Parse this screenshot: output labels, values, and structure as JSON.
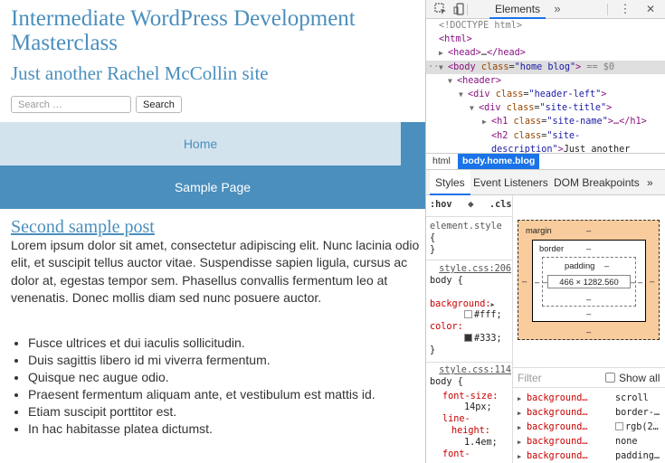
{
  "site": {
    "name": "Intermediate WordPress Development Masterclass",
    "description": "Just another Rachel McCollin site",
    "search": {
      "placeholder": "Search …",
      "button_label": "Search"
    },
    "nav": [
      {
        "label": "Home"
      },
      {
        "label": "Sample Page"
      }
    ],
    "post": {
      "title": "Second sample post",
      "body": "Lorem ipsum dolor sit amet, consectetur adipiscing elit. Nunc lacinia odio elit, et suscipit tellus auctor vitae. Suspendisse sapien ligula, cursus ac dolor at, egestas tempor sem. Phasellus convallis fermentum leo at venenatis. Donec mollis diam sed nunc posuere auctor.",
      "list": [
        "Fusce ultrices et dui iaculis sollicitudin.",
        "Duis sagittis libero id mi viverra fermentum.",
        "Quisque nec augue odio.",
        "Praesent fermentum aliquam ante, et vestibulum est mattis id.",
        "Etiam suscipit porttitor est.",
        "In hac habitasse platea dictumst."
      ]
    }
  },
  "devtools": {
    "toolbar": {
      "elements_tab": "Elements",
      "more": "»",
      "menu": "⋮",
      "close": "✕"
    },
    "dom": {
      "doctype": "<!DOCTYPE html>",
      "html_tag": "<html>",
      "head_line": {
        "open": "<head>",
        "ellipsis": "…",
        "close": "</head>"
      },
      "body_line": {
        "tag": "<body",
        "attr": "class",
        "val": "\"home blog\"",
        "close": ">",
        "marker": "== $0"
      },
      "header_tag": "<header>",
      "div_header_left": {
        "tag": "<div",
        "attr": "class",
        "val": "\"header-left\"",
        "close": ">"
      },
      "div_site_title": {
        "tag": "<div",
        "attr": "class",
        "val": "\"site-title\"",
        "close": ">"
      },
      "h1_line": {
        "tag": "<h1",
        "attr": "class",
        "val": "\"site-name\"",
        "rest": ">…</h1>"
      },
      "h2_line1": {
        "tag": "<h2",
        "attr": "class",
        "val": "\"site-"
      },
      "h2_line2": {
        "val": "description\"",
        "close": ">",
        "text": "Just another"
      }
    },
    "breadcrumbs": {
      "html": "html",
      "body": "body.home.blog"
    },
    "pane_tabs": {
      "styles": "Styles",
      "events": "Event Listeners",
      "dom_breakpoints": "DOM Breakpoints",
      "more": "»"
    },
    "styles_filter": {
      "hov": ":hov",
      "cls": ".cls"
    },
    "rules": {
      "element_style": {
        "selector": "element.style",
        "open": "{",
        "close": "}"
      },
      "rule1": {
        "source": "style.css:206",
        "selector": "body {",
        "prop1": "background:",
        "val1": "#fff;",
        "prop2": "color:",
        "val2": "#333;",
        "close": "}"
      },
      "rule2": {
        "source": "style.css:114",
        "selector": "body {",
        "prop1": "font-size:",
        "val1": "14px;",
        "prop2a": "line-",
        "prop2b": "height:",
        "val2": "1.4em;",
        "prop3": "font-"
      }
    },
    "box_model": {
      "margin_label": "margin",
      "border_label": "border",
      "padding_label": "padding",
      "content_size": "466 × 1282.560",
      "dash": "–"
    },
    "computed": {
      "filter_placeholder": "Filter",
      "show_all": "Show all",
      "rows": [
        {
          "prop": "background…",
          "val": "scroll"
        },
        {
          "prop": "background…",
          "val": "border-…"
        },
        {
          "prop": "background…",
          "val": "rgb(2…"
        },
        {
          "prop": "background…",
          "val": "none"
        },
        {
          "prop": "background…",
          "val": "padding…"
        }
      ]
    }
  }
}
